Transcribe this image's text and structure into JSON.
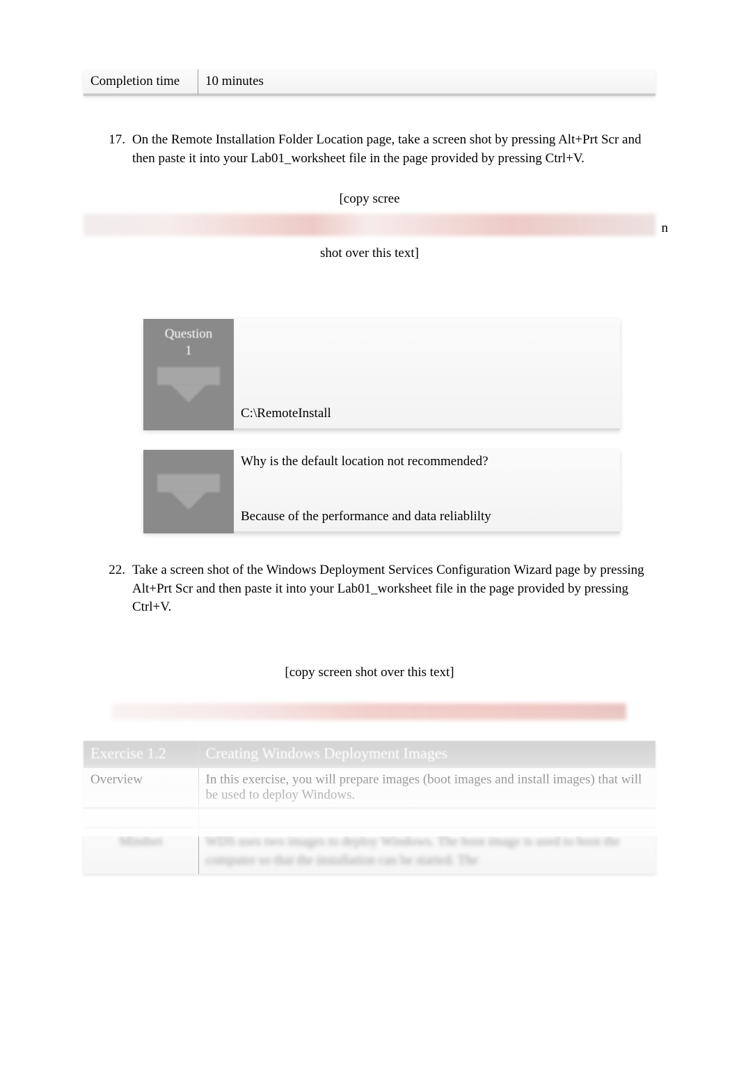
{
  "completion": {
    "label": "Completion time",
    "value": "10 minutes"
  },
  "step17": {
    "number": "17.",
    "text": "On the Remote Installation Folder Location page, take a screen shot by pressing Alt+Prt Scr and then paste it into your Lab01_worksheet file in the page provided by pressing Ctrl+V."
  },
  "placeholder1": {
    "line1": "[copy scree",
    "line2_right": "n",
    "line3": "shot over this text]"
  },
  "question1": {
    "label_line1": "Question",
    "label_line2": "1",
    "answer": "C:\\RemoteInstall"
  },
  "question2": {
    "prompt": "Why is the default location not recommended?",
    "answer": "Because of the performance and data reliablilty"
  },
  "step22": {
    "number": "22.",
    "text": "Take a screen shot of the Windows Deployment Services Configuration Wizard page by pressing Alt+Prt Scr and then paste it into your Lab01_worksheet file in the page provided by pressing Ctrl+V."
  },
  "placeholder2": "[copy screen shot over this text]",
  "exercise": {
    "number": "Exercise 1.2",
    "title": "Creating Windows Deployment Images",
    "overview_label": "Overview",
    "overview_text": "In this exercise, you will prepare images (boot images and install images) that will be used to deploy Windows.",
    "blurred_left": "Mindset",
    "blurred_right": "WDS uses two images to deploy Windows. The boot image is used to boot the computer so that the installation can be started. The"
  }
}
